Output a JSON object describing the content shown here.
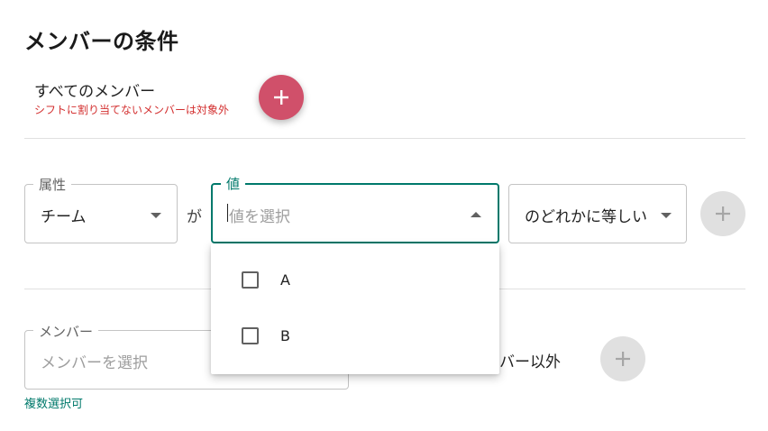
{
  "section": {
    "title": "メンバーの条件",
    "all_members_label": "すべてのメンバー",
    "all_members_note": "シフトに割り当てないメンバーは対象外"
  },
  "condition": {
    "attribute": {
      "legend": "属性",
      "value": "チーム"
    },
    "connector": "が",
    "value_field": {
      "legend": "値",
      "placeholder": "値を選択",
      "expanded": true
    },
    "operator": {
      "value": "のどれかに等しい"
    }
  },
  "dropdown": {
    "options": [
      {
        "label": "A",
        "checked": false
      },
      {
        "label": "B",
        "checked": false
      }
    ]
  },
  "member_filter": {
    "legend": "メンバー",
    "placeholder": "メンバーを選択",
    "note": "複数選択可",
    "except_label": "バー以外"
  },
  "colors": {
    "accent": "#00796b",
    "danger": "#d32f2f",
    "fab_red": "#d0506a",
    "fab_grey": "#e0e0e0"
  },
  "icons": {
    "add": "plus-icon",
    "dropdown_closed": "arrow-drop-down-icon",
    "dropdown_open": "arrow-drop-up-icon"
  }
}
